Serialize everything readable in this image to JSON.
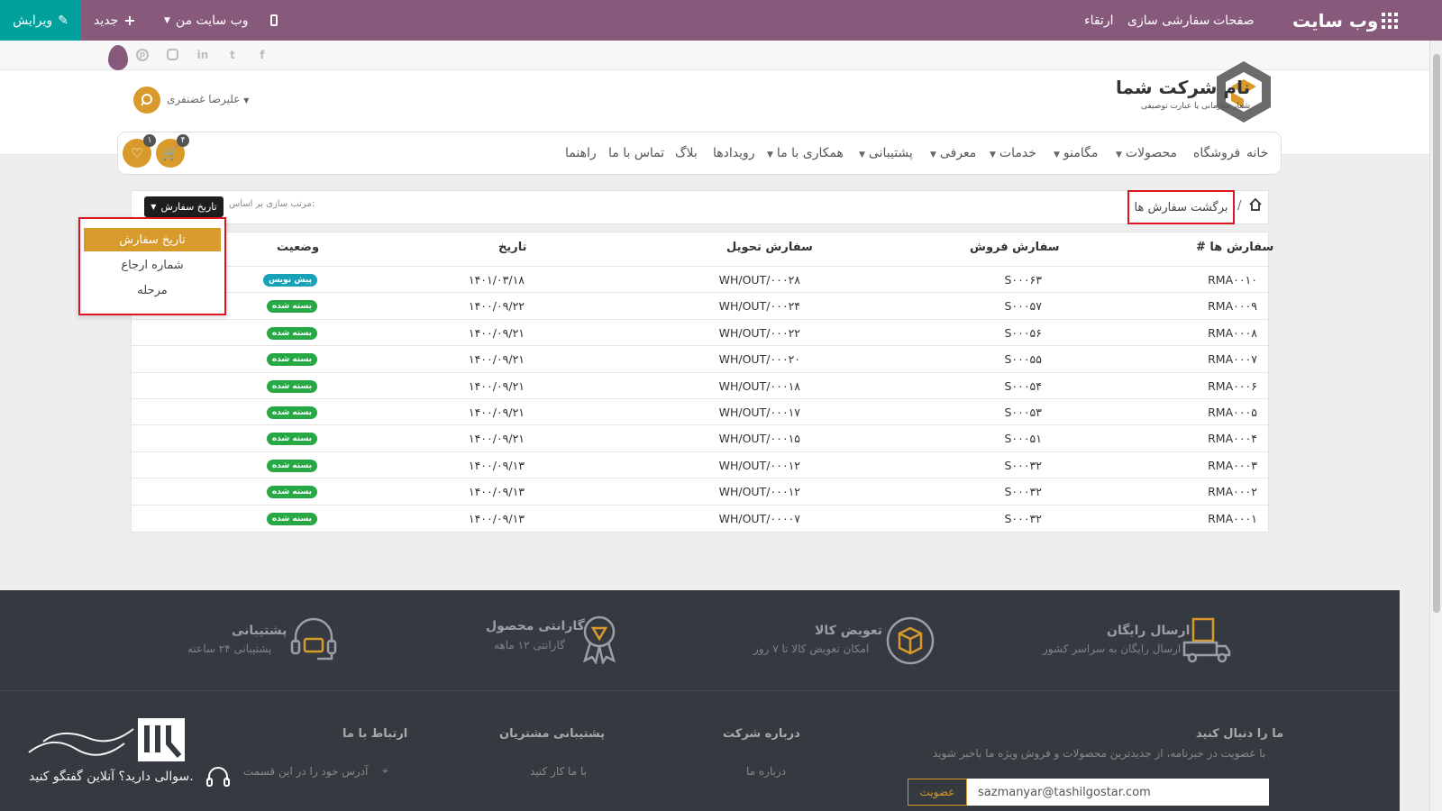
{
  "topbar": {
    "apps_icon": "grid-icon",
    "brand": "وب سایت",
    "menu": [
      "صفحات",
      "سفارشی سازی",
      "ارتقاء"
    ],
    "mobile_icon": "mobile-icon",
    "my_website": "وب سایت من",
    "new_label": "جدید",
    "edit_label": "ویرایش",
    "colors": {
      "bar": "#875a7b",
      "edit": "#00a09d"
    }
  },
  "social": [
    "facebook-icon",
    "twitter-icon",
    "linkedin-icon",
    "instagram-icon",
    "pinterest-icon"
  ],
  "header": {
    "company_name": "نام شرکت شما",
    "company_slogan": "شعار سازمانی یا عبارت توصیفی",
    "user_name": "علیرضا غضنفری"
  },
  "nav": {
    "items": [
      {
        "label": "خانه",
        "dropdown": false
      },
      {
        "label": "فروشگاه",
        "dropdown": false
      },
      {
        "label": "محصولات",
        "dropdown": true
      },
      {
        "label": "مگامنو",
        "dropdown": true
      },
      {
        "label": "خدمات",
        "dropdown": true
      },
      {
        "label": "معرفی",
        "dropdown": true
      },
      {
        "label": "پشتیبانی",
        "dropdown": true
      },
      {
        "label": "همکاری با ما",
        "dropdown": true
      },
      {
        "label": "رویدادها",
        "dropdown": false
      },
      {
        "label": "بلاگ",
        "dropdown": false
      },
      {
        "label": "تماس با ما",
        "dropdown": false
      },
      {
        "label": "راهنما",
        "dropdown": false
      }
    ],
    "cart_count": "۴",
    "wishlist_count": "۱",
    "accent": "#d79a2b"
  },
  "breadcrumb": {
    "back_label": "برگشت سفارش ها",
    "separator": "/",
    "sort_label": "مرتب سازی بر اساس:",
    "sort_value": "تاریخ سفارش"
  },
  "sort_menu": {
    "options": [
      "تاریخ سفارش",
      "شماره ارجاع",
      "مرحله"
    ],
    "active": "تاریخ سفارش"
  },
  "table": {
    "headers": {
      "rma": "# سفارش ها",
      "sale": "سفارش فروش",
      "delivery": "سفارش تحویل",
      "date": "تاریخ",
      "status": "وضعیت"
    },
    "rows": [
      {
        "rma": "RMA۰۰۱۰",
        "sale": "S۰۰۰۶۳",
        "delivery": "WH/OUT/۰۰۰۲۸",
        "date": "۱۴۰۱/۰۳/۱۸",
        "status": "پیش نویس",
        "status_color": "#17a2b8"
      },
      {
        "rma": "RMA۰۰۰۹",
        "sale": "S۰۰۰۵۷",
        "delivery": "WH/OUT/۰۰۰۲۴",
        "date": "۱۴۰۰/۰۹/۲۲",
        "status": "بسته شده",
        "status_color": "#28a745"
      },
      {
        "rma": "RMA۰۰۰۸",
        "sale": "S۰۰۰۵۶",
        "delivery": "WH/OUT/۰۰۰۲۲",
        "date": "۱۴۰۰/۰۹/۲۱",
        "status": "بسته شده",
        "status_color": "#28a745"
      },
      {
        "rma": "RMA۰۰۰۷",
        "sale": "S۰۰۰۵۵",
        "delivery": "WH/OUT/۰۰۰۲۰",
        "date": "۱۴۰۰/۰۹/۲۱",
        "status": "بسته شده",
        "status_color": "#28a745"
      },
      {
        "rma": "RMA۰۰۰۶",
        "sale": "S۰۰۰۵۴",
        "delivery": "WH/OUT/۰۰۰۱۸",
        "date": "۱۴۰۰/۰۹/۲۱",
        "status": "بسته شده",
        "status_color": "#28a745"
      },
      {
        "rma": "RMA۰۰۰۵",
        "sale": "S۰۰۰۵۳",
        "delivery": "WH/OUT/۰۰۰۱۷",
        "date": "۱۴۰۰/۰۹/۲۱",
        "status": "بسته شده",
        "status_color": "#28a745"
      },
      {
        "rma": "RMA۰۰۰۴",
        "sale": "S۰۰۰۵۱",
        "delivery": "WH/OUT/۰۰۰۱۵",
        "date": "۱۴۰۰/۰۹/۲۱",
        "status": "بسته شده",
        "status_color": "#28a745"
      },
      {
        "rma": "RMA۰۰۰۳",
        "sale": "S۰۰۰۳۲",
        "delivery": "WH/OUT/۰۰۰۱۲",
        "date": "۱۴۰۰/۰۹/۱۳",
        "status": "بسته شده",
        "status_color": "#28a745"
      },
      {
        "rma": "RMA۰۰۰۲",
        "sale": "S۰۰۰۳۲",
        "delivery": "WH/OUT/۰۰۰۱۲",
        "date": "۱۴۰۰/۰۹/۱۳",
        "status": "بسته شده",
        "status_color": "#28a745"
      },
      {
        "rma": "RMA۰۰۰۱",
        "sale": "S۰۰۰۳۲",
        "delivery": "WH/OUT/۰۰۰۰۷",
        "date": "۱۴۰۰/۰۹/۱۳",
        "status": "بسته شده",
        "status_color": "#28a745"
      }
    ]
  },
  "features": [
    {
      "title": "ارسال رایگان",
      "subtitle": "ارسال رایگان به سراسر کشور",
      "icon": "truck-icon"
    },
    {
      "title": "تعویض کالا",
      "subtitle": "امکان تعویض کالا تا ۷ روز",
      "icon": "box-return-icon"
    },
    {
      "title": "گارانتی محصول",
      "subtitle": "گارانتی ۱۲ ماهه",
      "icon": "award-icon"
    },
    {
      "title": "پشتیبانی",
      "subtitle": "پشتیبانی ۲۴ ساعته",
      "icon": "headset-icon"
    }
  ],
  "footer": {
    "follow_title": "ما را دنبال کنید",
    "follow_text": "با عضویت در خبرنامه، از جدیدترین محصولات و فروش ویژه ما باخبر شوید",
    "newsletter_value": "sazmanyar@tashilgostar.com",
    "newsletter_button": "عضویت",
    "about_title": "درباره شرکت",
    "about_link": "درباره ما",
    "support_title": "پشتیبانی مشتریان",
    "support_link": "با ما کار کنید",
    "contact_title": "ارتباط با ما",
    "contact_address": "آدرس خود را در این قسمت",
    "chat_text": "سوالی دارید؟ آنلاین گفتگو کنید."
  }
}
